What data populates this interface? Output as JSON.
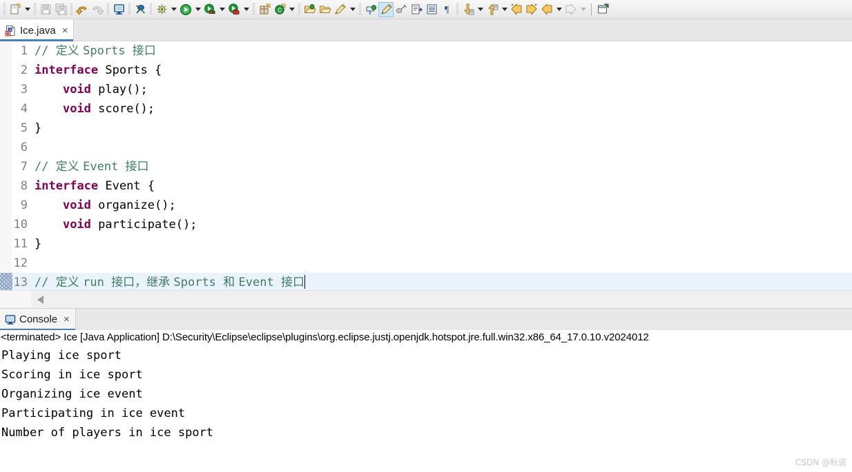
{
  "toolbar": {
    "items": [
      {
        "name": "new-file-icon",
        "kind": "icon",
        "label": "New"
      },
      {
        "name": "new-file-dropdown-arrow",
        "kind": "arrow",
        "label": "New menu"
      },
      {
        "name": "separator",
        "kind": "sep",
        "label": ""
      },
      {
        "name": "save-icon",
        "kind": "icon",
        "label": "Save"
      },
      {
        "name": "save-all-icon",
        "kind": "icon",
        "label": "Save All"
      },
      {
        "name": "separator",
        "kind": "sep",
        "label": ""
      },
      {
        "name": "undo-icon",
        "kind": "icon",
        "label": "Undo"
      },
      {
        "name": "redo-icon",
        "kind": "icon",
        "label": "Redo"
      },
      {
        "name": "separator",
        "kind": "sep",
        "label": ""
      },
      {
        "name": "display-view-icon",
        "kind": "icon",
        "label": "Display Selected Console"
      },
      {
        "name": "separator",
        "kind": "sep",
        "label": ""
      },
      {
        "name": "skip-breakpoints-icon",
        "kind": "icon",
        "label": "Skip All Breakpoints"
      },
      {
        "name": "separator",
        "kind": "sep",
        "label": ""
      },
      {
        "name": "debug-icon",
        "kind": "icon",
        "label": "Debug"
      },
      {
        "name": "debug-dropdown-arrow",
        "kind": "arrow",
        "label": "Debug menu"
      },
      {
        "name": "run-icon",
        "kind": "icon",
        "label": "Run"
      },
      {
        "name": "run-dropdown-arrow",
        "kind": "arrow",
        "label": "Run menu"
      },
      {
        "name": "coverage-icon",
        "kind": "icon",
        "label": "Coverage"
      },
      {
        "name": "coverage-dropdown-arrow",
        "kind": "arrow",
        "label": "Coverage menu"
      },
      {
        "name": "external-tools-icon",
        "kind": "icon",
        "label": "External Tools"
      },
      {
        "name": "external-tools-dropdown-arrow",
        "kind": "arrow",
        "label": "External Tools menu"
      },
      {
        "name": "separator",
        "kind": "sep",
        "label": ""
      },
      {
        "name": "new-java-package-icon",
        "kind": "icon",
        "label": "New Java Package"
      },
      {
        "name": "new-class-icon",
        "kind": "icon",
        "label": "New Java Class"
      },
      {
        "name": "new-class-dropdown-arrow",
        "kind": "arrow",
        "label": "New Class menu"
      },
      {
        "name": "separator",
        "kind": "sep",
        "label": ""
      },
      {
        "name": "open-type-icon",
        "kind": "icon",
        "label": "Open Type"
      },
      {
        "name": "open-task-icon",
        "kind": "icon",
        "label": "Open Task"
      },
      {
        "name": "search-marker-icon",
        "kind": "icon",
        "label": "Search"
      },
      {
        "name": "search-dropdown-arrow",
        "kind": "arrow",
        "label": "Search menu"
      },
      {
        "name": "separator",
        "kind": "sep",
        "label": ""
      },
      {
        "name": "pin-editor-icon",
        "kind": "icon",
        "label": "Pin Editor"
      },
      {
        "name": "toggle-mark-occurrences-icon",
        "kind": "icon",
        "label": "Toggle Mark Occurrences",
        "selected": true
      },
      {
        "name": "link-with-editor-icon",
        "kind": "icon",
        "label": "Link with Editor"
      },
      {
        "name": "show-source-icon",
        "kind": "icon",
        "label": "Show Source of Selected Element"
      },
      {
        "name": "show-outline-icon",
        "kind": "icon",
        "label": "Show Outline"
      },
      {
        "name": "show-whitespace-icon",
        "kind": "icon",
        "label": "Show Whitespace Characters"
      },
      {
        "name": "separator",
        "kind": "sep",
        "label": ""
      },
      {
        "name": "next-annotation-icon",
        "kind": "icon",
        "label": "Next Annotation"
      },
      {
        "name": "next-annotation-dropdown-arrow",
        "kind": "arrow",
        "label": "Next Annotation menu"
      },
      {
        "name": "previous-annotation-icon",
        "kind": "icon",
        "label": "Previous Annotation"
      },
      {
        "name": "previous-annotation-dropdown-arrow",
        "kind": "arrow",
        "label": "Previous Annotation menu"
      },
      {
        "name": "last-edit-location-icon",
        "kind": "icon",
        "label": "Last Edit Location"
      },
      {
        "name": "next-edit-location-icon",
        "kind": "icon",
        "label": "Next Edit Location"
      },
      {
        "name": "back-icon",
        "kind": "icon",
        "label": "Back"
      },
      {
        "name": "back-dropdown-arrow",
        "kind": "arrow",
        "label": "Back history"
      },
      {
        "name": "forward-icon",
        "kind": "icon",
        "label": "Forward"
      },
      {
        "name": "forward-dropdown-arrow",
        "kind": "arrow",
        "label": "Forward history"
      },
      {
        "name": "separator-solid",
        "kind": "sepsolid",
        "label": ""
      },
      {
        "name": "new-window-icon",
        "kind": "icon",
        "label": "New Window"
      }
    ]
  },
  "editor_tab": {
    "filename": "Ice.java",
    "close_label": "×",
    "icon": "java-file-error-icon"
  },
  "code": {
    "lines": [
      {
        "num": "1",
        "tokens": [
          {
            "t": "// ",
            "c": "cm"
          },
          {
            "t": "定义 ",
            "c": "cm cjk"
          },
          {
            "t": "Sports ",
            "c": "cm"
          },
          {
            "t": "接口",
            "c": "cm cjk"
          }
        ]
      },
      {
        "num": "2",
        "tokens": [
          {
            "t": "interface",
            "c": "k"
          },
          {
            "t": " Sports {",
            "c": "pl"
          }
        ]
      },
      {
        "num": "3",
        "tokens": [
          {
            "t": "    ",
            "c": "pl"
          },
          {
            "t": "void",
            "c": "k"
          },
          {
            "t": " play();",
            "c": "pl"
          }
        ]
      },
      {
        "num": "4",
        "tokens": [
          {
            "t": "    ",
            "c": "pl"
          },
          {
            "t": "void",
            "c": "k"
          },
          {
            "t": " score();",
            "c": "pl"
          }
        ]
      },
      {
        "num": "5",
        "tokens": [
          {
            "t": "}",
            "c": "pl"
          }
        ]
      },
      {
        "num": "6",
        "tokens": []
      },
      {
        "num": "7",
        "tokens": [
          {
            "t": "// ",
            "c": "cm"
          },
          {
            "t": "定义 ",
            "c": "cm cjk"
          },
          {
            "t": "Event ",
            "c": "cm"
          },
          {
            "t": "接口",
            "c": "cm cjk"
          }
        ]
      },
      {
        "num": "8",
        "tokens": [
          {
            "t": "interface",
            "c": "k"
          },
          {
            "t": " Event {",
            "c": "pl"
          }
        ]
      },
      {
        "num": "9",
        "tokens": [
          {
            "t": "    ",
            "c": "pl"
          },
          {
            "t": "void",
            "c": "k"
          },
          {
            "t": " organize();",
            "c": "pl"
          }
        ]
      },
      {
        "num": "10",
        "tokens": [
          {
            "t": "    ",
            "c": "pl"
          },
          {
            "t": "void",
            "c": "k"
          },
          {
            "t": " participate();",
            "c": "pl"
          }
        ]
      },
      {
        "num": "11",
        "tokens": [
          {
            "t": "}",
            "c": "pl"
          }
        ]
      },
      {
        "num": "12",
        "tokens": []
      },
      {
        "num": "13",
        "highlight": true,
        "dirty": true,
        "caret": true,
        "tokens": [
          {
            "t": "// ",
            "c": "cm"
          },
          {
            "t": "定义 ",
            "c": "cm cjk"
          },
          {
            "t": "run ",
            "c": "cm"
          },
          {
            "t": "接口，继承 ",
            "c": "cm cjk"
          },
          {
            "t": "Sports ",
            "c": "cm"
          },
          {
            "t": "和 ",
            "c": "cm cjk"
          },
          {
            "t": "Event ",
            "c": "cm"
          },
          {
            "t": "接口",
            "c": "cm cjk"
          }
        ]
      }
    ]
  },
  "console": {
    "tab_label": "Console",
    "tab_close_label": "×",
    "tab_icon": "console-monitor-icon",
    "terminated_line": "<terminated> Ice [Java Application] D:\\Security\\Eclipse\\eclipse\\plugins\\org.eclipse.justj.openjdk.hotspot.jre.full.win32.x86_64_17.0.10.v2024012",
    "output": [
      "Playing ice sport",
      "Scoring in ice sport",
      "Organizing ice event",
      "Participating in ice event",
      "Number of players in ice sport"
    ]
  },
  "watermark": "CSDN @秋说",
  "colors": {
    "keyword": "#7f0055",
    "comment": "#3f7f5f",
    "plain": "#000000",
    "line_number": "#808080",
    "active_line": "#eaf2fb",
    "tab_underline": "#4a7ebb"
  }
}
